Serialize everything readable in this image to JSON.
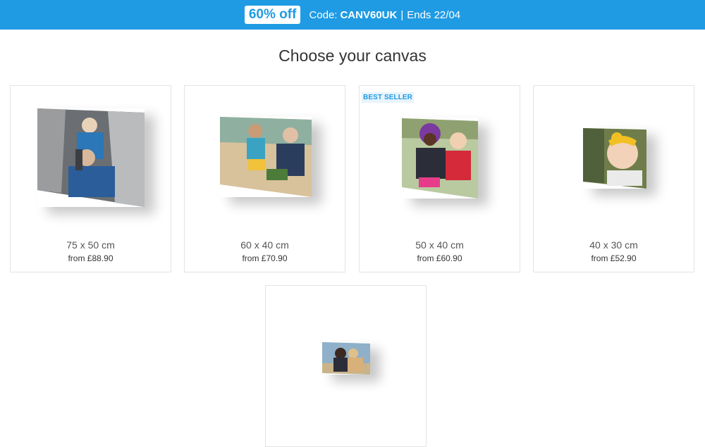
{
  "banner": {
    "discount": "60% off",
    "code_label": "Code:",
    "code_value": "CANV60UK",
    "separator": "|",
    "ends": "Ends 22/04"
  },
  "page": {
    "title": "Choose your canvas"
  },
  "products": [
    {
      "size": "75 x 50 cm",
      "price": "from  £88.90",
      "badge": ""
    },
    {
      "size": "60 x 40 cm",
      "price": "from  £70.90",
      "badge": ""
    },
    {
      "size": "50 x 40 cm",
      "price": "from  £60.90",
      "badge": "BEST SELLER"
    },
    {
      "size": "40 x 30 cm",
      "price": "from  £52.90",
      "badge": ""
    },
    {
      "size": "",
      "price": "",
      "badge": ""
    }
  ],
  "colors": {
    "accent": "#1f9be4"
  }
}
